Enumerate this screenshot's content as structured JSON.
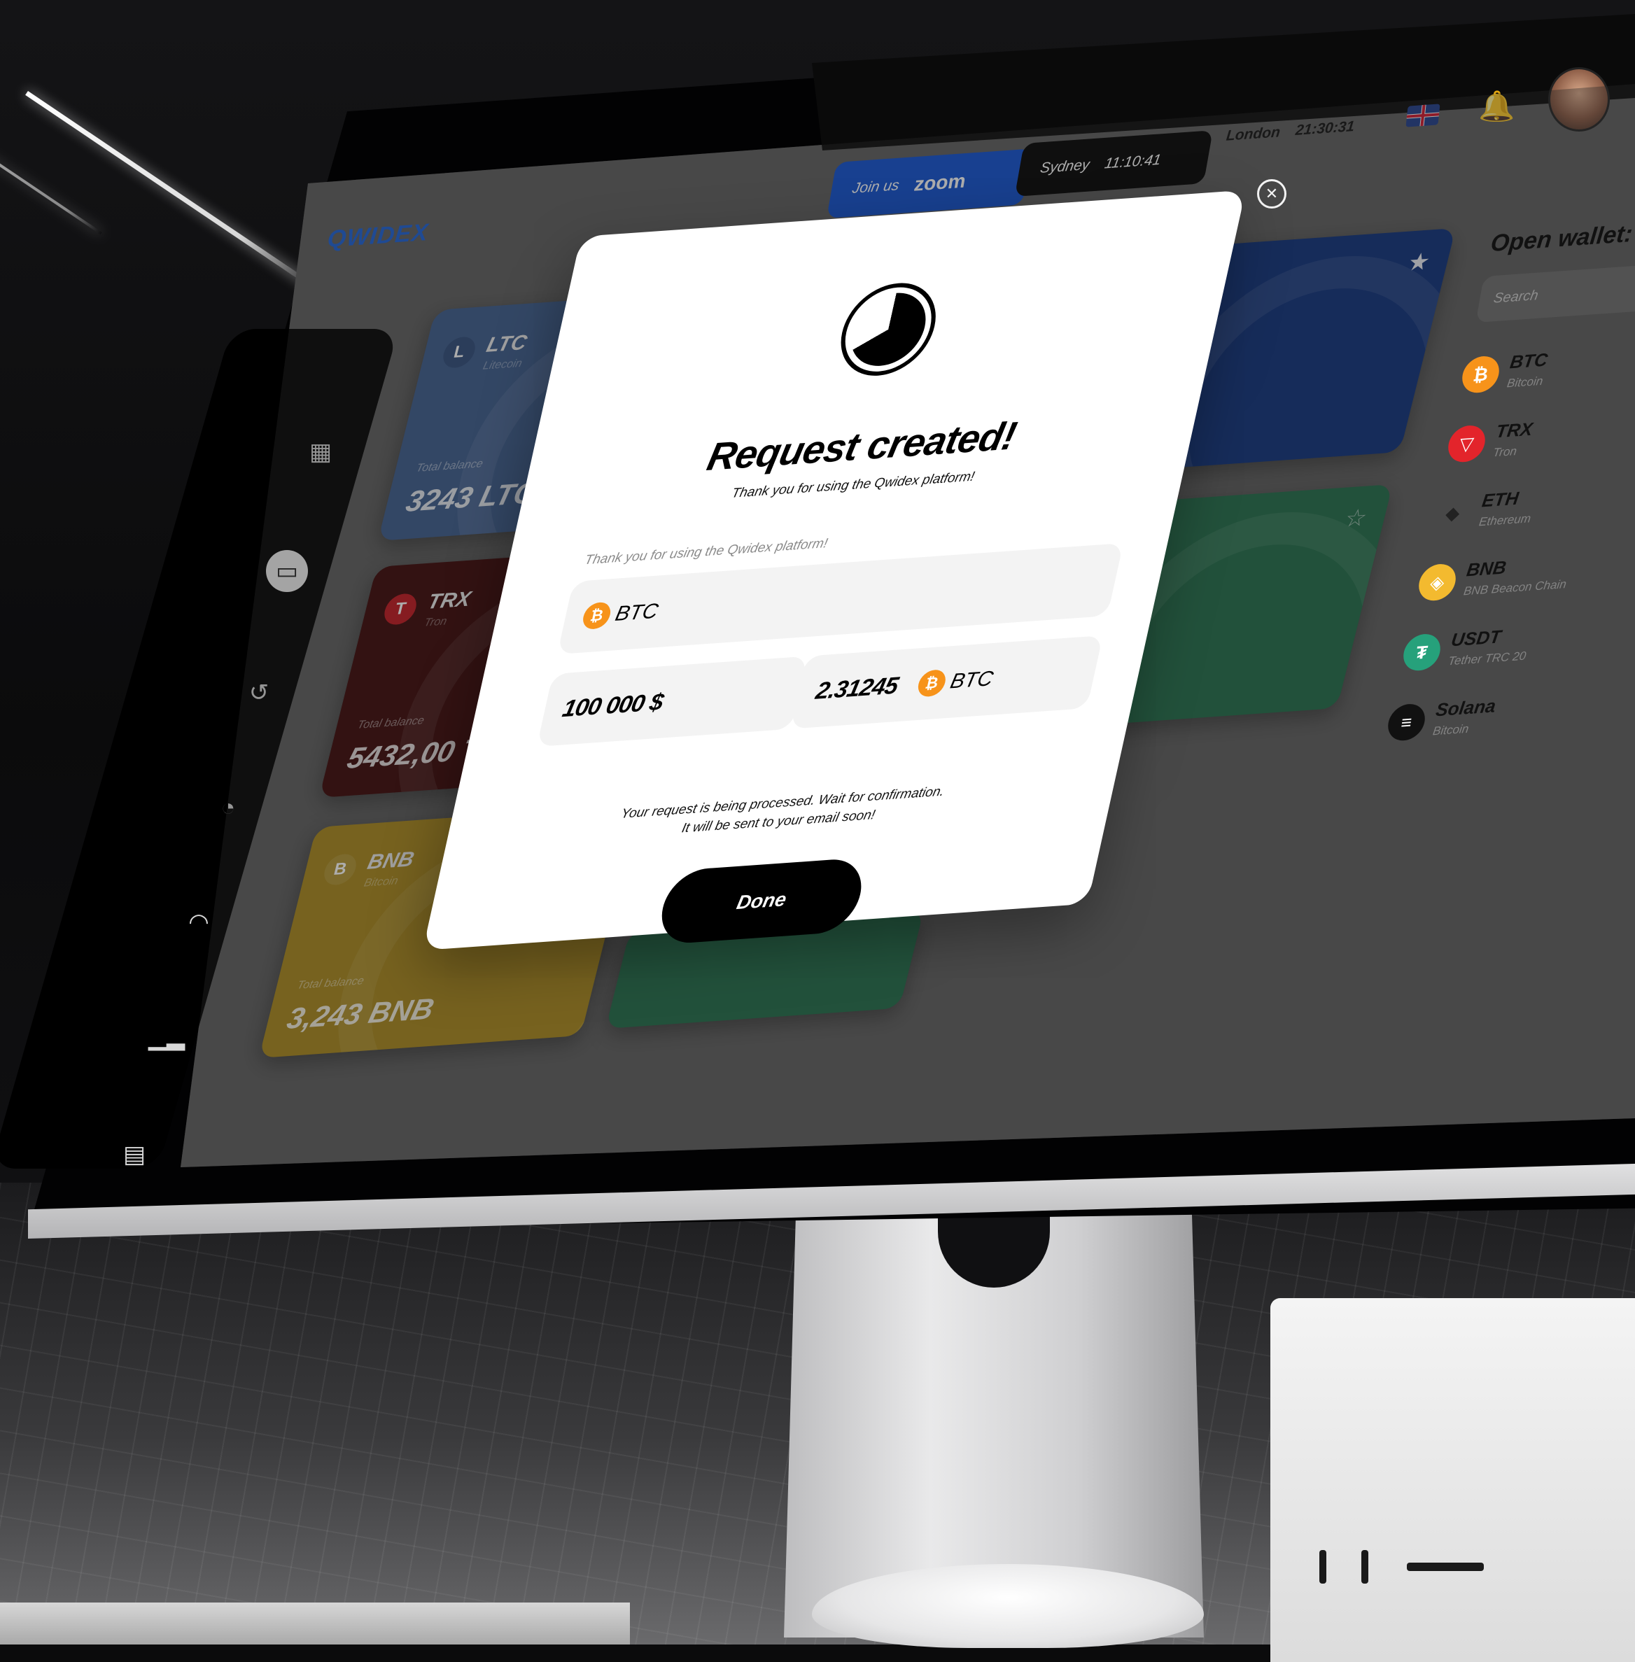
{
  "app": {
    "logo_text": "QWIDEX"
  },
  "header": {
    "zoom_label": "Join us",
    "zoom_brand": "zoom",
    "clocks": [
      {
        "city": "Sydney",
        "time": "11:10:41"
      },
      {
        "city": "London",
        "time": "21:30:31"
      }
    ],
    "flag_icon": "uk-flag-icon",
    "bell_icon": "bell-icon"
  },
  "sidebar": {
    "icons": [
      "grid-icon",
      "wallet-card-icon",
      "history-icon",
      "pie-chart-icon",
      "speedometer-icon",
      "bar-chart-icon",
      "media-icon"
    ]
  },
  "cards": [
    {
      "symbol": "LTC",
      "name": "Litecoin",
      "balance_label": "Total balance",
      "balance": "3243 LTC",
      "color": "#3b5b8c",
      "icon": "L"
    },
    {
      "symbol": "TRX",
      "name": "Tron",
      "balance_label": "Total balance",
      "balance": "5432,00 TRX",
      "color": "#3a0606",
      "icon": "T"
    },
    {
      "symbol": "BNB",
      "name": "Bitcoin",
      "balance_label": "Total balance",
      "balance": "3,243 BNB",
      "color": "#a8871a",
      "icon": "B"
    }
  ],
  "wallet_panel": {
    "title": "Open wallet:",
    "search_placeholder": "Search",
    "items": [
      {
        "symbol": "BTC",
        "name": "Bitcoin",
        "color": "#f7931a",
        "icon": "₿"
      },
      {
        "symbol": "TRX",
        "name": "Tron",
        "color": "#e3242b",
        "icon": "▽"
      },
      {
        "symbol": "ETH",
        "name": "Ethereum",
        "color": "#2b2b2b",
        "icon": "◆"
      },
      {
        "symbol": "BNB",
        "name": "BNB Beacon Chain",
        "color": "#f3ba2f",
        "icon": "◈"
      },
      {
        "symbol": "USDT",
        "name": "Tether TRC 20",
        "color": "#26a17b",
        "icon": "₮"
      },
      {
        "symbol": "Solana",
        "name": "Bitcoin",
        "color": "#111111",
        "icon": "≡"
      }
    ]
  },
  "modal": {
    "title": "Request created!",
    "subtitle": "Thank you for using the Qwidex platform!",
    "field_label": "Thank you for using the Qwidex platform!",
    "currency": "BTC",
    "amount_fiat": "100 000 $",
    "amount_crypto": "2.31245",
    "crypto_currency": "BTC",
    "note_line1": "Your request is being processed. Wait for confirmation.",
    "note_line2": "It will be sent to your email soon!",
    "done_label": "Done"
  }
}
